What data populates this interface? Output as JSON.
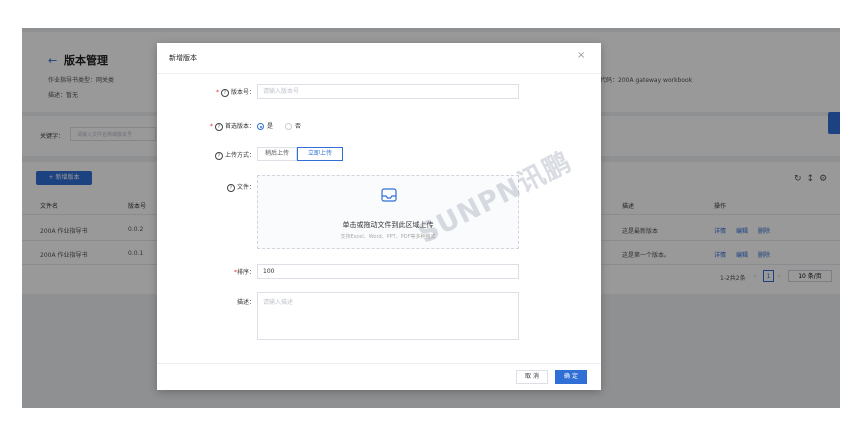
{
  "page": {
    "back_icon": "arrow-left-icon",
    "title": "版本管理",
    "category_label": "作业指导书类型：",
    "category_value": "网关类",
    "desc_label": "描述：",
    "desc_value": "暂无",
    "code_label": "代码：",
    "code_value": "200A gateway workbook",
    "keyword_label": "关键字：",
    "keyword_placeholder": "请输入文件名称或版本号",
    "add_button": "+ 新增版本",
    "toolbar_icons": [
      "refresh-icon",
      "column-height-icon",
      "settings-icon"
    ],
    "table": {
      "columns": [
        "文件名",
        "版本号",
        "描述",
        "操作"
      ],
      "rows": [
        {
          "name": "200A 作业指导书",
          "version": "0.0.2",
          "desc": "这是最新版本",
          "actions": [
            "详情",
            "编辑",
            "删除"
          ]
        },
        {
          "name": "200A 作业指导书",
          "version": "0.0.1",
          "desc": "这是第一个版本。",
          "actions": [
            "详情",
            "编辑",
            "删除"
          ]
        }
      ]
    },
    "pagination": {
      "total_text": "1-2共2条",
      "current_page": "1",
      "page_size": "10 条/页"
    }
  },
  "modal": {
    "title": "新增版本",
    "close_icon": "close-icon",
    "version_label": "版本号：",
    "version_placeholder": "请输入版本号",
    "preferred_label": "首选版本：",
    "preferred_options": [
      "是",
      "否"
    ],
    "preferred_selected": "是",
    "upload_label": "上传方式：",
    "upload_options": [
      "稍后上传",
      "立即上传"
    ],
    "upload_selected": "立即上传",
    "file_label": "文件：",
    "file_drop_icon": "inbox-icon",
    "file_drop_text": "单击或拖动文件到此区域上传",
    "file_drop_hint": "支持Excel、Word、PPT、PDF等多种格式",
    "sort_label": "排序：",
    "sort_value": "100",
    "desc_label": "描述：",
    "desc_placeholder": "请输入描述",
    "cancel_button": "取 消",
    "ok_button": "确 定"
  },
  "watermark": "SUNPN讯鹏",
  "colors": {
    "primary": "#2f6fd6",
    "required": "#f5222d",
    "overlay": "rgba(0,0,0,0.40)"
  }
}
